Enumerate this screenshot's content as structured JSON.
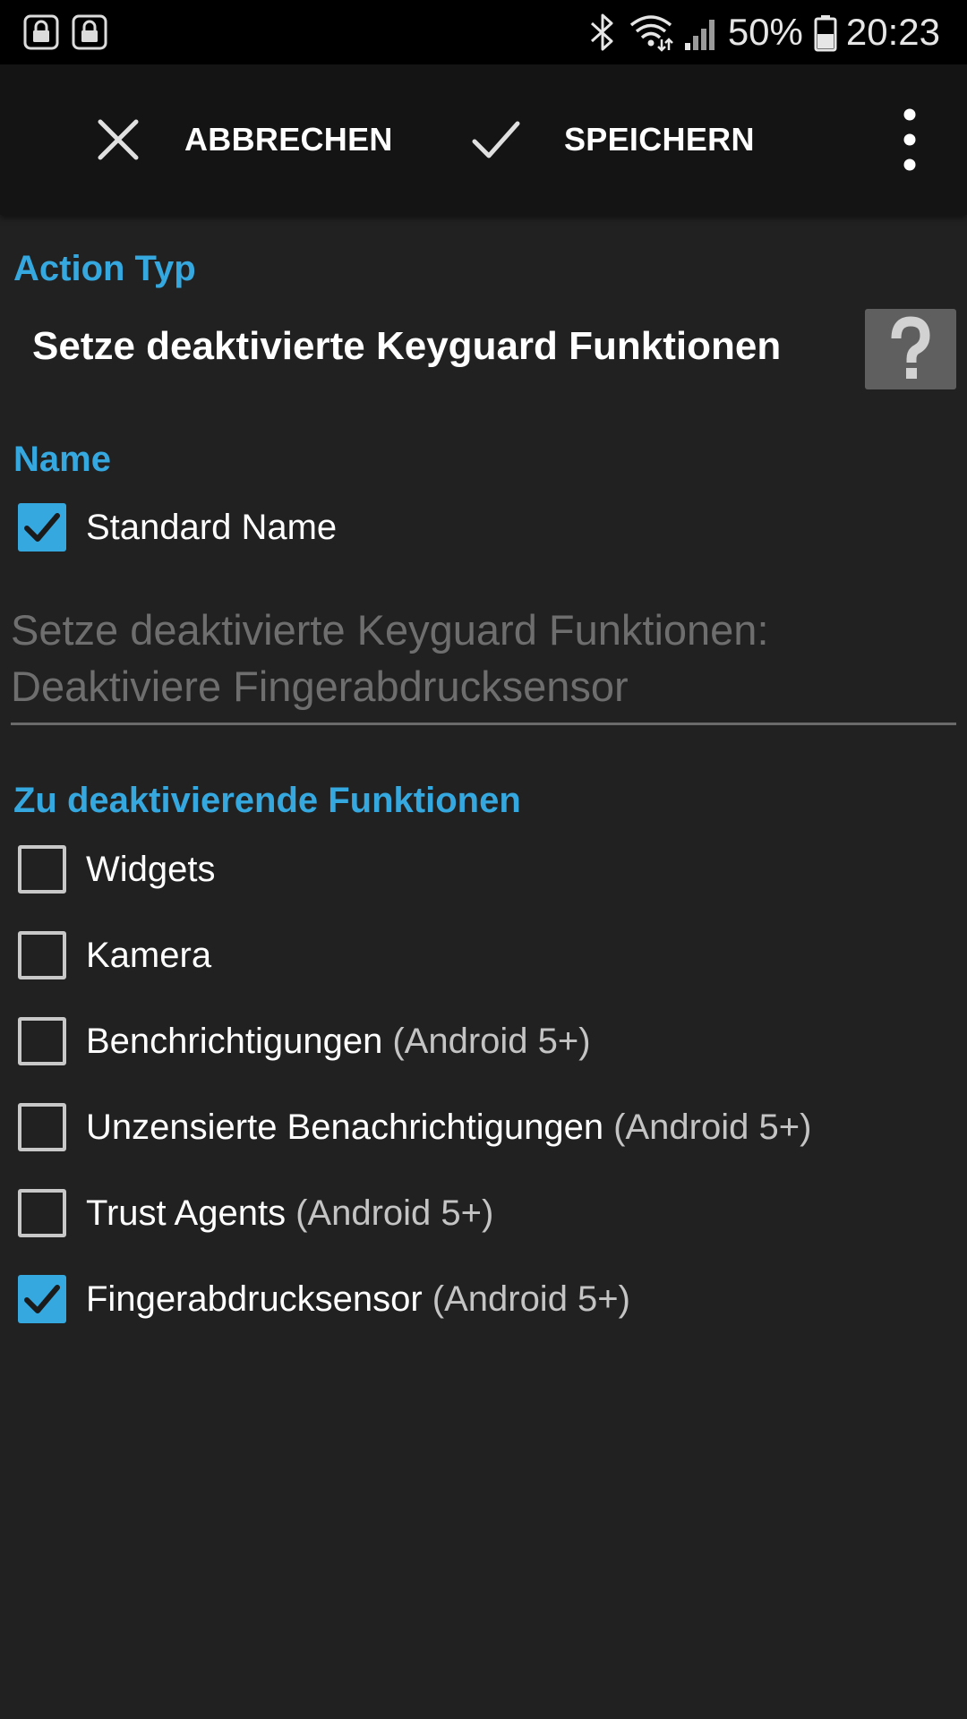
{
  "status_bar": {
    "battery_percent": "50%",
    "time": "20:23",
    "icons": [
      "lock-icon",
      "lock-icon",
      "bluetooth-icon",
      "wifi-icon",
      "cellular-signal-icon",
      "battery-icon"
    ]
  },
  "toolbar": {
    "cancel_label": "ABBRECHEN",
    "save_label": "SPEICHERN",
    "icons": [
      "close-icon",
      "check-icon",
      "overflow-menu-icon"
    ]
  },
  "action_type": {
    "heading": "Action Typ",
    "value": "Setze deaktivierte Keyguard Funktionen",
    "help_icon": "help-icon"
  },
  "name": {
    "heading": "Name",
    "standard_name_label": "Standard Name",
    "standard_name_checked": true,
    "field_line1": "Setze deaktivierte Keyguard Funktionen:",
    "field_line2": "Deaktiviere Fingerabdrucksensor"
  },
  "features": {
    "heading": "Zu deaktivierende Funktionen",
    "items": [
      {
        "label": "Widgets",
        "hint": "",
        "checked": false
      },
      {
        "label": "Kamera",
        "hint": "",
        "checked": false
      },
      {
        "label": "Benchrichtigungen",
        "hint": "(Android 5+)",
        "checked": false
      },
      {
        "label": "Unzensierte Benachrichtigungen",
        "hint": "(Android 5+)",
        "checked": false
      },
      {
        "label": "Trust Agents",
        "hint": "(Android 5+)",
        "checked": false
      },
      {
        "label": "Fingerabdrucksensor",
        "hint": "(Android 5+)",
        "checked": true
      }
    ]
  },
  "colors": {
    "accent": "#35a8e0",
    "background": "#212121",
    "toolbar": "#141414",
    "status_bar": "#000000",
    "hint_text": "#6e6e6e"
  }
}
